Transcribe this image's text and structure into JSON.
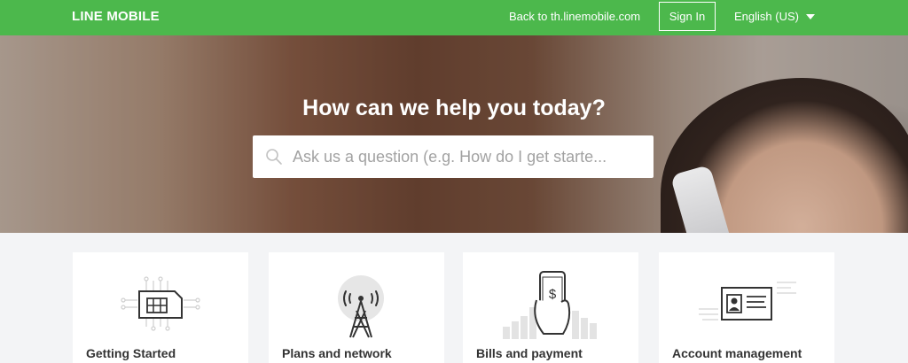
{
  "header": {
    "logo": "LINE MOBILE",
    "back_link": "Back to th.linemobile.com",
    "signin": "Sign In",
    "language": "English (US)"
  },
  "hero": {
    "title": "How can we help you today?",
    "search_placeholder": "Ask us a question (e.g. How do I get starte..."
  },
  "categories": [
    {
      "label": "Getting Started",
      "icon": "sim-card-icon"
    },
    {
      "label": "Plans and network",
      "icon": "signal-tower-icon"
    },
    {
      "label": "Bills and payment",
      "icon": "payment-phone-icon"
    },
    {
      "label": "Account management",
      "icon": "id-card-icon"
    }
  ],
  "colors": {
    "brand_green": "#4cb84c",
    "background": "#f3f4f6",
    "card": "#ffffff"
  }
}
